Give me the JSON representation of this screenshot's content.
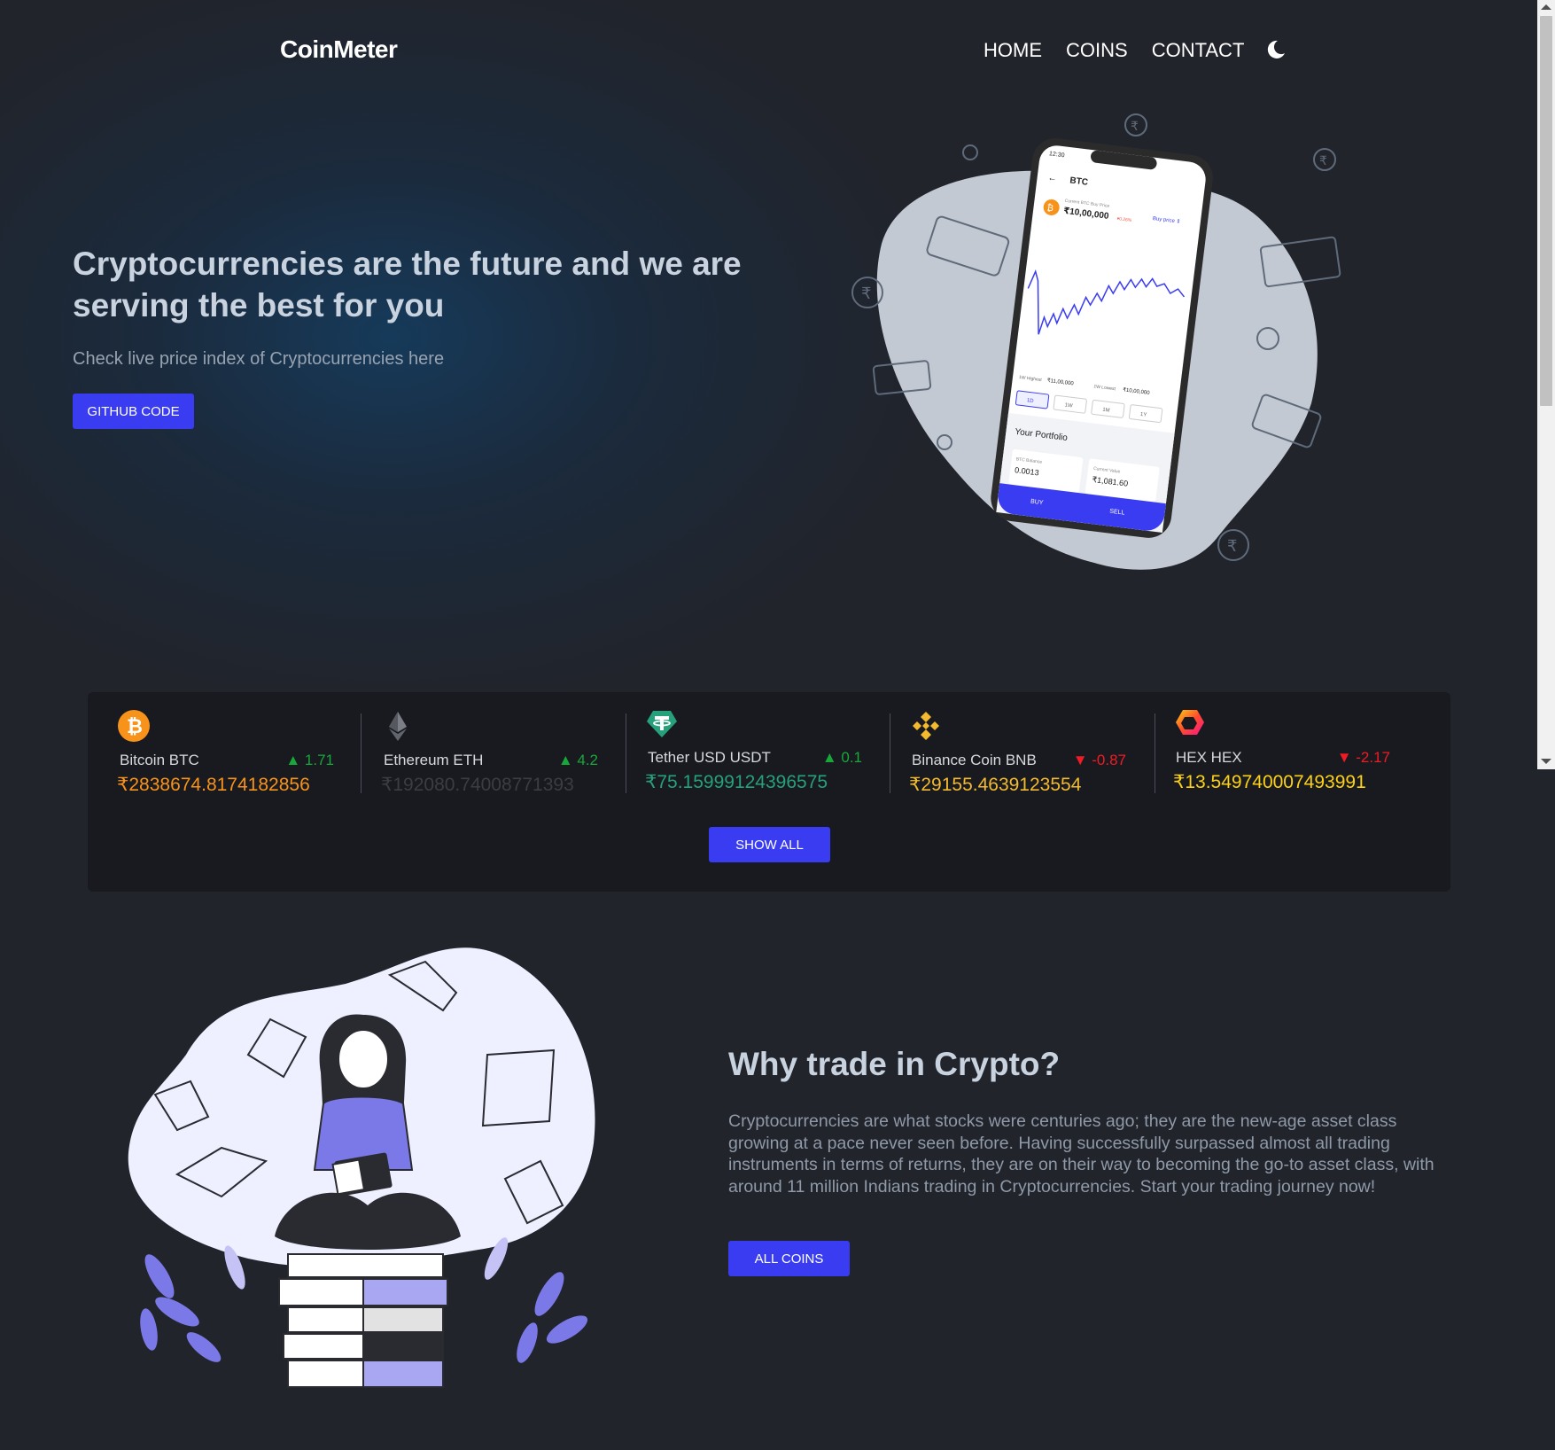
{
  "nav": {
    "brand": "CoinMeter",
    "links": [
      "HOME",
      "COINS",
      "CONTACT"
    ],
    "theme_icon": "moon-icon"
  },
  "hero": {
    "title": "Cryptocurrencies are the future and we are serving the best for you",
    "subtitle": "Check live price index of Cryptocurrencies here",
    "button": "GITHUB CODE",
    "phone": {
      "coin": "BTC",
      "buy_price_label": "Current BTC Buy Price",
      "buy_price": "₹10,00,000",
      "buy_price_change": "▾0.26%",
      "buy_price_link": "Buy price ⇕",
      "high_label": "1W Highest",
      "high_value": "₹11,00,000",
      "low_label": "1W Lowest",
      "low_value": "₹10,00,000",
      "ranges": [
        "1D",
        "1W",
        "1M",
        "1Y"
      ],
      "portfolio_title": "Your Portfolio",
      "balance_label": "BTC Balance",
      "balance_value": "0.0013",
      "value_label": "Current Value",
      "value_value": "₹1,081.60",
      "buy": "BUY",
      "sell": "SELL",
      "time": "12:30"
    }
  },
  "ticker": {
    "coins": [
      {
        "name": "Bitcoin BTC",
        "change": "▲ 1.71",
        "direction": "up",
        "price": "₹2838674.8174182856",
        "price_color": "#f7931a",
        "icon": "bitcoin-icon"
      },
      {
        "name": "Ethereum ETH",
        "change": "▲ 4.2",
        "direction": "up",
        "price": "₹192080.74008771393",
        "price_color": "#3a3d44",
        "icon": "ethereum-icon"
      },
      {
        "name": "Tether USD USDT",
        "change": "▲ 0.1",
        "direction": "up",
        "price": "₹75.15999124396575",
        "price_color": "#26a17b",
        "icon": "tether-icon"
      },
      {
        "name": "Binance Coin BNB",
        "change": "▼ -0.87",
        "direction": "down",
        "price": "₹29155.4639123554",
        "price_color": "#f3ba2f",
        "icon": "binance-icon"
      },
      {
        "name": "HEX HEX",
        "change": "▼ -2.17",
        "direction": "down",
        "price": "₹13.549740007493991",
        "price_color": "#fcd116",
        "icon": "hex-icon"
      }
    ],
    "button": "SHOW ALL"
  },
  "why": {
    "title": "Why trade in Crypto?",
    "text": "Cryptocurrencies are what stocks were centuries ago; they are the new-age asset class growing at a pace never seen before. Having successfully surpassed almost all trading instruments in terms of returns, they are on their way to becoming the go-to asset class, with around 11 million Indians trading in Cryptocurrencies. Start your trading journey now!",
    "button": "ALL COINS"
  },
  "colors": {
    "accent": "#3a3cf2",
    "up": "#18a83a",
    "down": "#f01b24",
    "background": "#21242b",
    "card": "#191a1f"
  }
}
